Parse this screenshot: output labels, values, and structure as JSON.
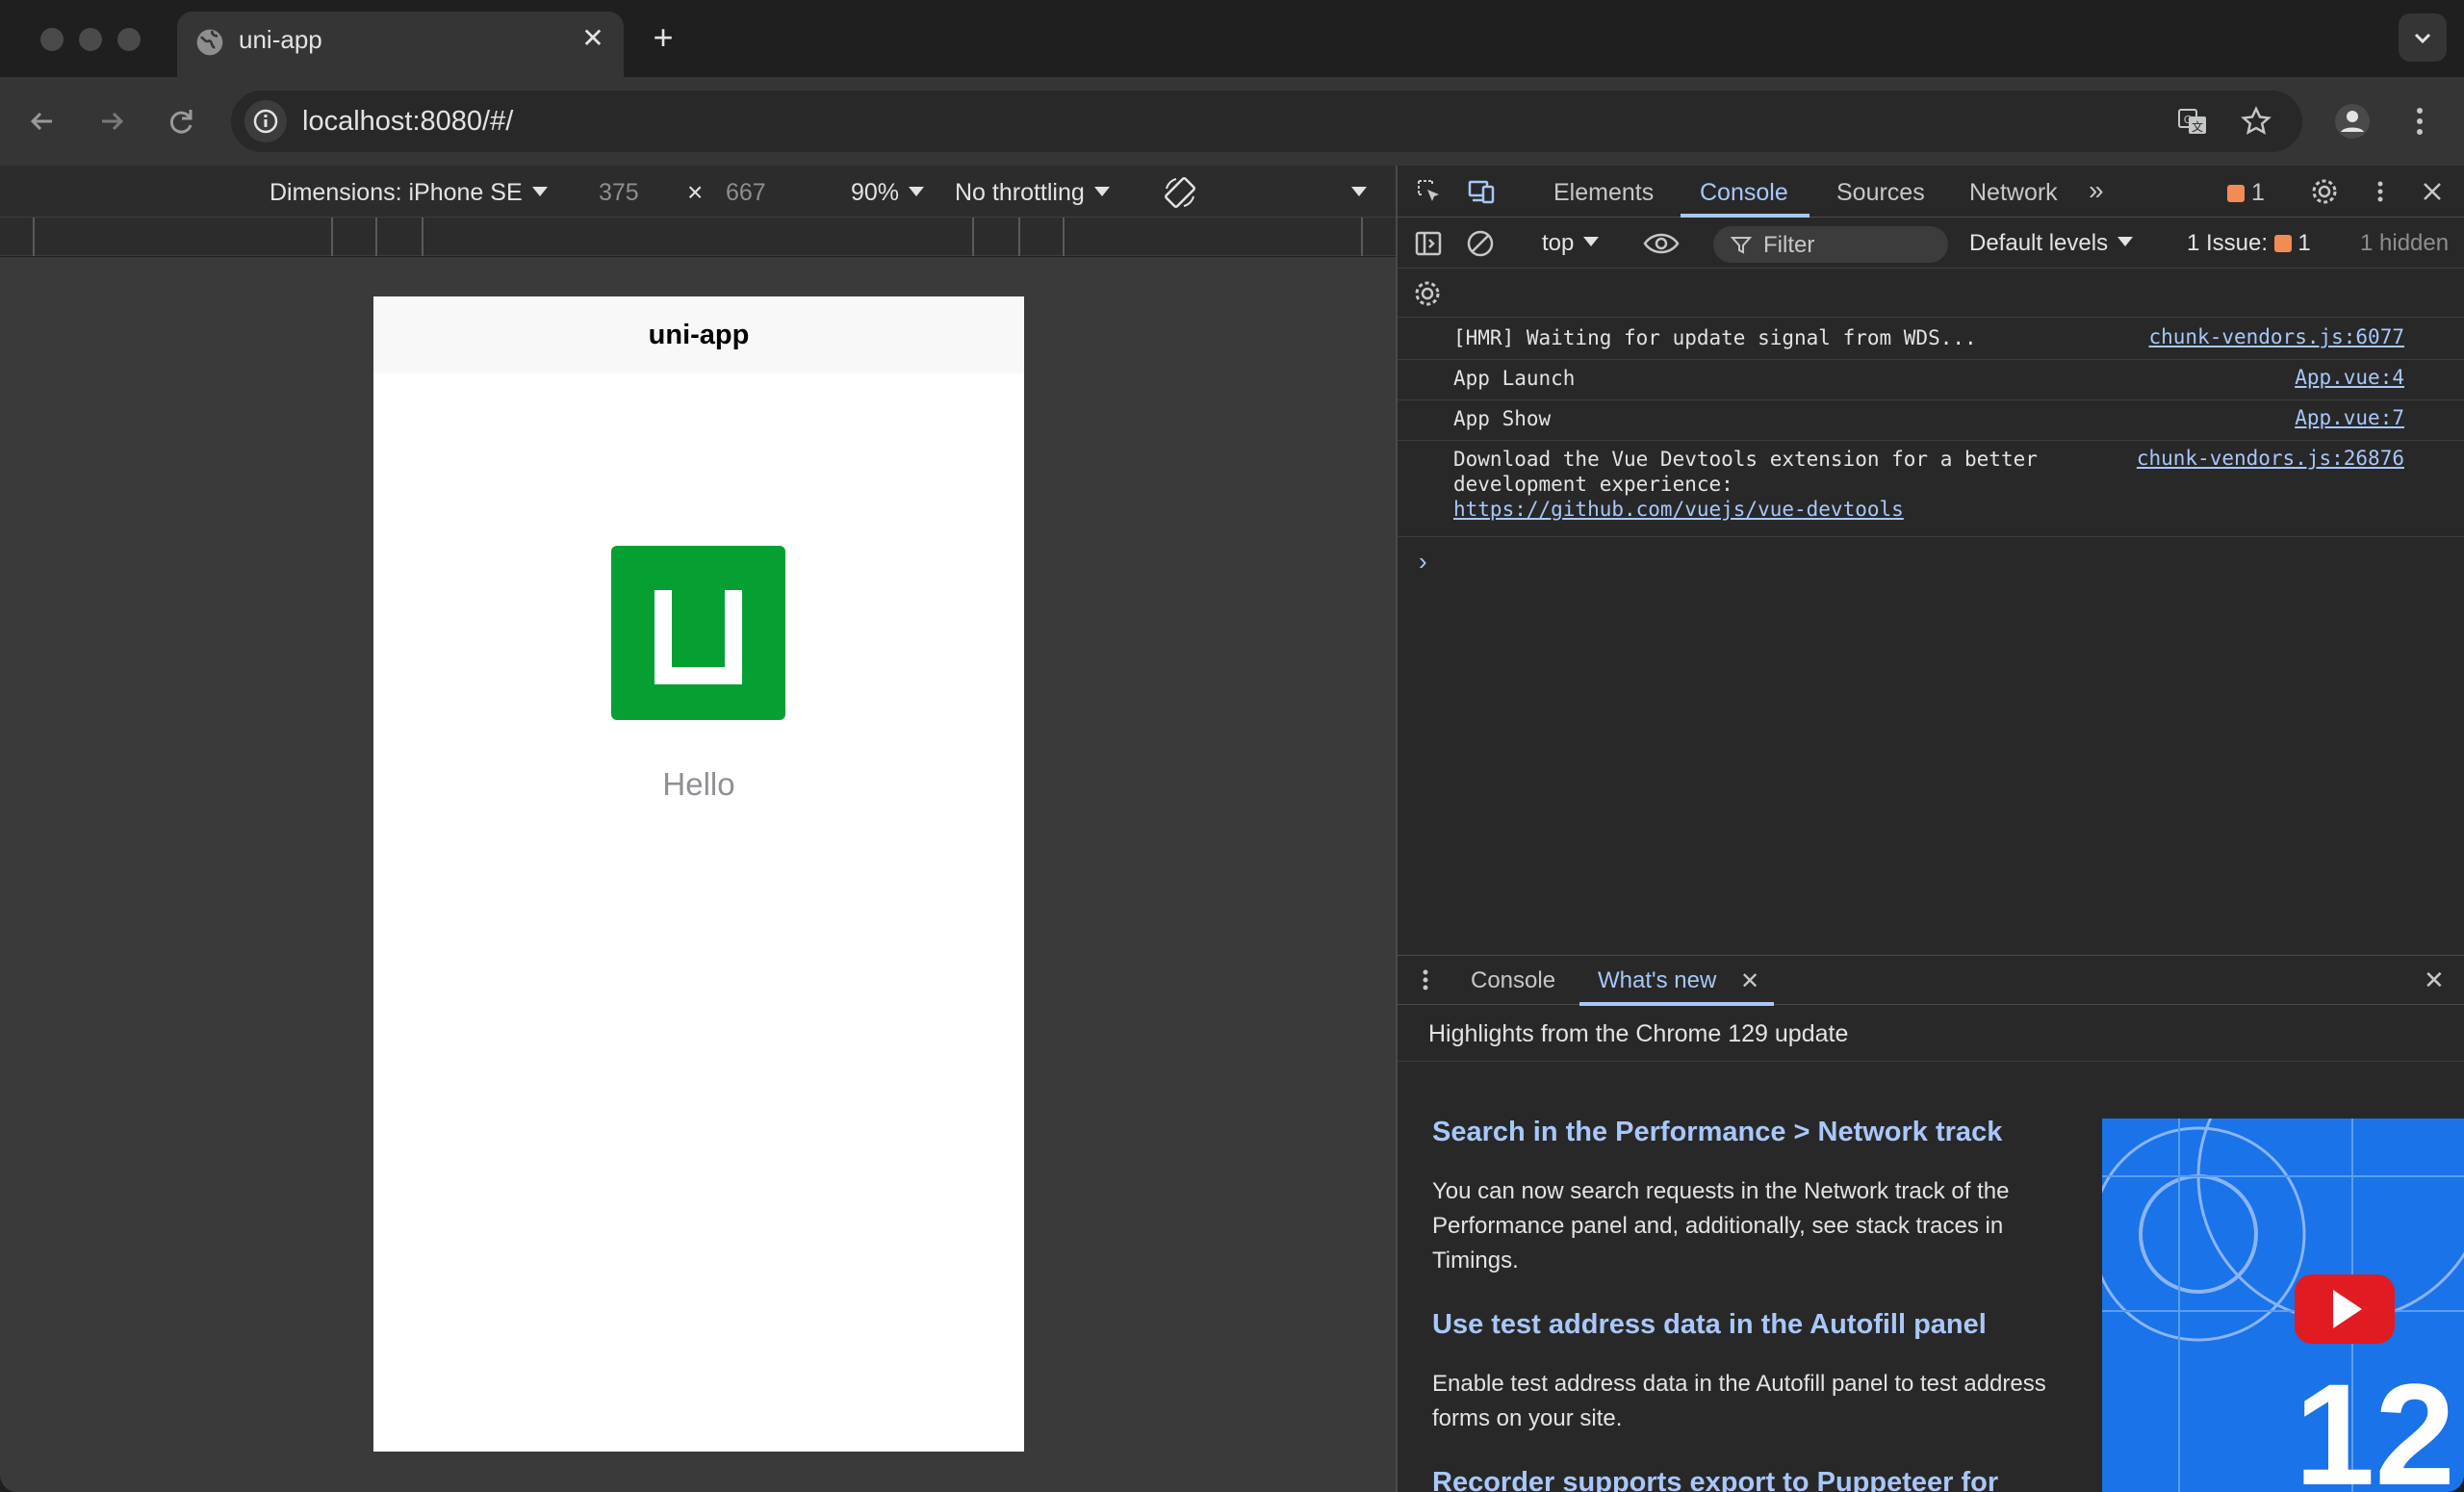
{
  "browser": {
    "tab_title": "uni-app",
    "url": "localhost:8080/#/"
  },
  "device_toolbar": {
    "dimensions_label": "Dimensions: iPhone SE",
    "width": "375",
    "times": "×",
    "height": "667",
    "zoom": "90%",
    "throttling": "No throttling"
  },
  "app": {
    "nav_title": "uni-app",
    "greeting": "Hello"
  },
  "devtools": {
    "tabs": [
      "Elements",
      "Console",
      "Sources",
      "Network"
    ],
    "issues_count": "1",
    "console_toolbar": {
      "context": "top",
      "filter_placeholder": "Filter",
      "levels": "Default levels",
      "issues_label": "1 Issue:",
      "issues_num": "1",
      "hidden": "1 hidden"
    },
    "logs": [
      {
        "message": "[HMR] Waiting for update signal from WDS...",
        "source": "chunk-vendors.js:6077"
      },
      {
        "message": "App Launch",
        "source": "App.vue:4"
      },
      {
        "message": "App Show",
        "source": "App.vue:7"
      },
      {
        "message": "Download the Vue Devtools extension for a better\ndevelopment experience:",
        "link": "https://github.com/vuejs/vue-devtools",
        "source": "chunk-vendors.js:26876"
      }
    ],
    "drawer": {
      "tabs": [
        "Console",
        "What's new"
      ],
      "header": "Highlights from the Chrome 129 update",
      "items": [
        {
          "title": "Search in the Performance > Network track",
          "body": "You can now search requests in the Network track of the Performance panel and, additionally, see stack traces in Timings."
        },
        {
          "title": "Use test address data in the Autofill panel",
          "body": "Enable test address data in the Autofill panel to test address forms on your site."
        },
        {
          "title": "Recorder supports export to Puppeteer for"
        }
      ],
      "image_text": "12"
    }
  },
  "colors": {
    "accent": "#a8c7fa",
    "uni_green": "#06a032",
    "issue_orange": "#f28b54"
  }
}
